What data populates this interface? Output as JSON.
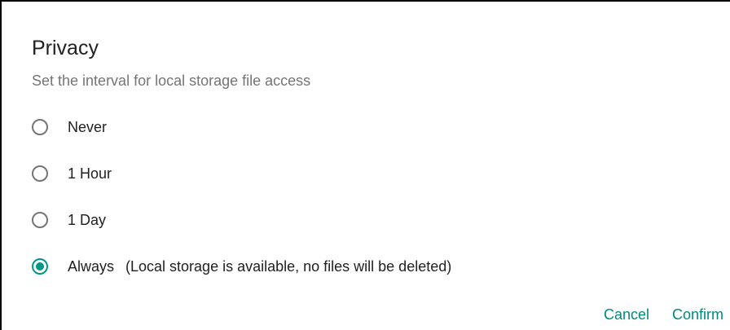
{
  "dialog": {
    "title": "Privacy",
    "subtitle": "Set the interval for local storage file access",
    "options": [
      {
        "label": "Never",
        "selected": false
      },
      {
        "label": "1 Hour",
        "selected": false
      },
      {
        "label": "1 Day",
        "selected": false
      },
      {
        "label": "Always",
        "note": "(Local storage is available, no files will be deleted)",
        "selected": true
      }
    ],
    "cancel_label": "Cancel",
    "confirm_label": "Confirm"
  },
  "colors": {
    "accent": "#009688",
    "unselected_radio": "#757575",
    "title_text": "#212121",
    "subtitle_text": "#757575"
  }
}
